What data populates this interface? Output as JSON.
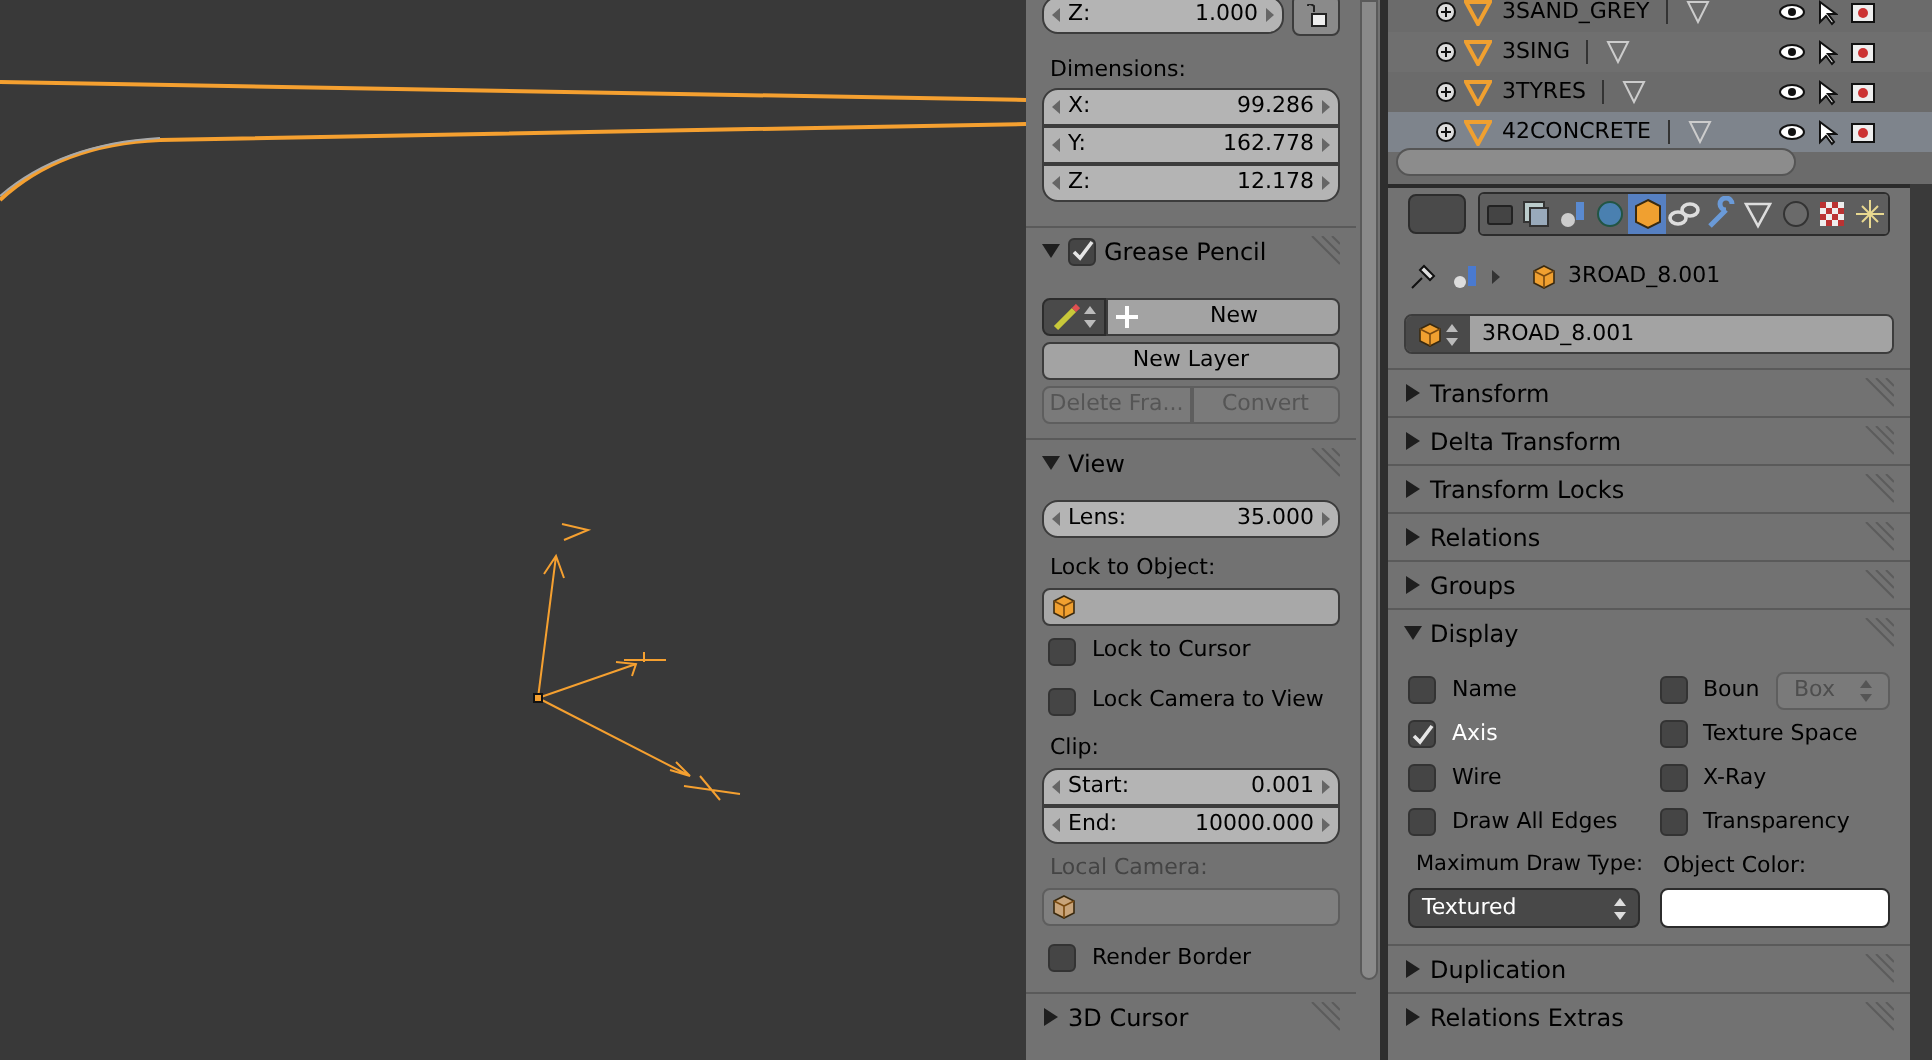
{
  "n_panel": {
    "location_z": {
      "label": "Z:",
      "value": "1.000"
    },
    "dimensions": {
      "label": "Dimensions:",
      "fields": [
        {
          "label": "X:",
          "value": "99.286"
        },
        {
          "label": "Y:",
          "value": "162.778"
        },
        {
          "label": "Z:",
          "value": "12.178"
        }
      ]
    },
    "grease_pencil": {
      "title": "Grease Pencil",
      "expanded": true,
      "checked": true,
      "new_button": "New",
      "new_layer_button": "New Layer",
      "buttons": [
        {
          "label": "Delete Fra...",
          "disabled": true
        },
        {
          "label": "Convert",
          "disabled": true
        }
      ]
    },
    "view": {
      "title": "View",
      "expanded": true,
      "lens": {
        "label": "Lens:",
        "value": "35.000"
      },
      "lock_to_object_label": "Lock to Object:",
      "checkboxes": [
        {
          "label": "Lock to Cursor",
          "checked": false
        },
        {
          "label": "Lock Camera to View",
          "checked": false
        }
      ],
      "clip_label": "Clip:",
      "clip": [
        {
          "label": "Start:",
          "value": "0.001"
        },
        {
          "label": "End:",
          "value": "10000.000"
        }
      ],
      "local_camera": {
        "label": "Local Camera:",
        "disabled": true
      },
      "render_border": {
        "label": "Render Border",
        "checked": false
      }
    },
    "cursor_panel": {
      "title": "3D Cursor",
      "expanded": false
    }
  },
  "outliner": {
    "rows": [
      {
        "name": "3SAND_GREY",
        "selected": false
      },
      {
        "name": "3SING",
        "selected": false
      },
      {
        "name": "3TYRES",
        "selected": false
      },
      {
        "name": "42CONCRETE",
        "selected": true
      }
    ]
  },
  "properties": {
    "tabs": [
      {
        "kind": "render",
        "selected": false
      },
      {
        "kind": "layers",
        "selected": false
      },
      {
        "kind": "scene",
        "selected": false
      },
      {
        "kind": "world",
        "selected": false
      },
      {
        "kind": "object",
        "selected": true
      },
      {
        "kind": "constraints",
        "selected": false
      },
      {
        "kind": "modifiers",
        "selected": false
      },
      {
        "kind": "data",
        "selected": false
      },
      {
        "kind": "material",
        "selected": false
      },
      {
        "kind": "texture",
        "selected": false
      },
      {
        "kind": "particles",
        "selected": false
      }
    ],
    "breadcrumb": "3ROAD_8.001",
    "object_name": "3ROAD_8.001",
    "panels_before": [
      {
        "title": "Transform",
        "expanded": false
      },
      {
        "title": "Delta Transform",
        "expanded": false
      },
      {
        "title": "Transform Locks",
        "expanded": false
      },
      {
        "title": "Relations",
        "expanded": false
      },
      {
        "title": "Groups",
        "expanded": false
      }
    ],
    "display": {
      "title": "Display",
      "expanded": true,
      "left": [
        {
          "label": "Name",
          "checked": false
        },
        {
          "label": "Axis",
          "checked": true
        },
        {
          "label": "Wire",
          "checked": false
        },
        {
          "label": "Draw All Edges",
          "checked": false
        }
      ],
      "right": [
        {
          "label": "Boun",
          "checked": false
        },
        {
          "label": "Texture Space",
          "checked": false
        },
        {
          "label": "X-Ray",
          "checked": false
        },
        {
          "label": "Transparency",
          "checked": false
        }
      ],
      "bounds_type": {
        "value": "Box",
        "disabled": true
      },
      "max_draw_type": {
        "label": "Maximum Draw Type:",
        "value": "Textured"
      },
      "object_color": {
        "label": "Object Color:"
      }
    },
    "panels_after": [
      {
        "title": "Duplication",
        "expanded": false
      },
      {
        "title": "Relations Extras",
        "expanded": false
      }
    ]
  }
}
